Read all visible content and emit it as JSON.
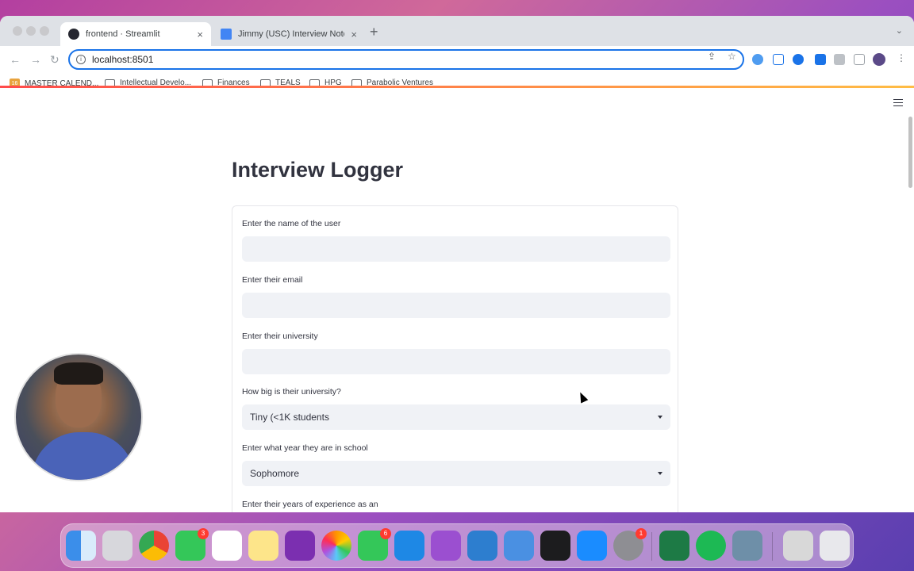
{
  "browser": {
    "tabs": [
      {
        "title": "frontend · Streamlit",
        "active": true,
        "favicon_color": "#262730"
      },
      {
        "title": "Jimmy (USC) Interview Notes",
        "active": false,
        "favicon_color": "#4285f4"
      }
    ],
    "address": "localhost:8501",
    "bookmarks": [
      {
        "label": "MASTER CALEND...",
        "icon": "calendar-icon"
      },
      {
        "label": "Intellectual Develo...",
        "icon": "folder-icon"
      },
      {
        "label": "Finances",
        "icon": "folder-icon"
      },
      {
        "label": "TEALS",
        "icon": "folder-icon"
      },
      {
        "label": "HPG",
        "icon": "folder-icon"
      },
      {
        "label": "Parabolic Ventures",
        "icon": "folder-icon"
      }
    ],
    "calendar_badge": "16"
  },
  "app": {
    "title": "Interview Logger",
    "fields": {
      "name_label": "Enter the name of the user",
      "email_label": "Enter their email",
      "university_label": "Enter their university",
      "size_label": "How big is their university?",
      "size_value": "Tiny (<1K students",
      "year_label": "Enter what year they are in school",
      "year_value": "Sophomore",
      "experience_label": "Enter their years of experience as an"
    }
  },
  "dock": {
    "badges": {
      "messages": "3",
      "facetime": "6",
      "preferences": "1"
    }
  },
  "colors": {
    "accent": "#1a73e8",
    "streamlit_red": "#ff4b4b",
    "input_bg": "#f0f2f6",
    "text": "#31333f"
  }
}
